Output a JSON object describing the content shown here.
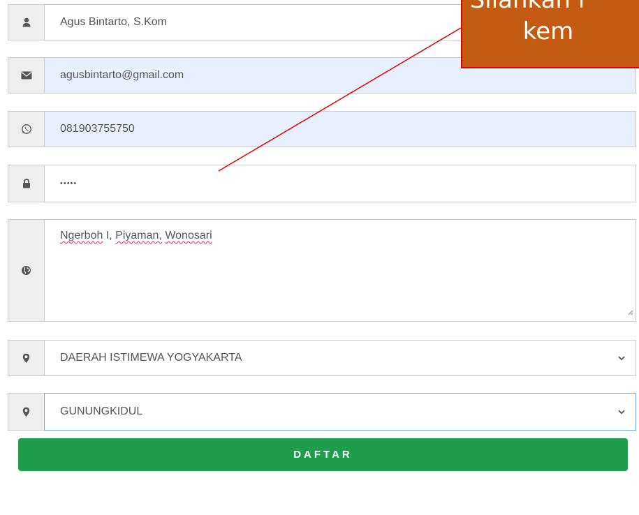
{
  "form": {
    "name_value": "Agus Bintarto, S.Kom",
    "email_value": "agusbintarto@gmail.com",
    "phone_value": "081903755750",
    "password_value": "•••••",
    "address_words": [
      "Ngerboh",
      "I,",
      "Piyaman,",
      "Wonosari"
    ],
    "province_selected": "DAERAH ISTIMEWA YOGYAKARTA",
    "regency_selected": "GUNUNGKIDUL",
    "submit_label": "DAFTAR"
  },
  "callout": {
    "line1": "Silahkan l",
    "line2": "kem"
  },
  "icons": {
    "name": "user-icon",
    "email": "envelope-icon",
    "phone": "whatsapp-icon",
    "password": "lock-icon",
    "address": "globe-icon",
    "province": "map-marker-icon",
    "regency": "map-marker-icon"
  },
  "colors": {
    "submit_bg": "#1e9e4a",
    "callout_bg": "#c55a11",
    "callout_border": "#e20000",
    "autofill_bg": "#e8f0fe"
  }
}
